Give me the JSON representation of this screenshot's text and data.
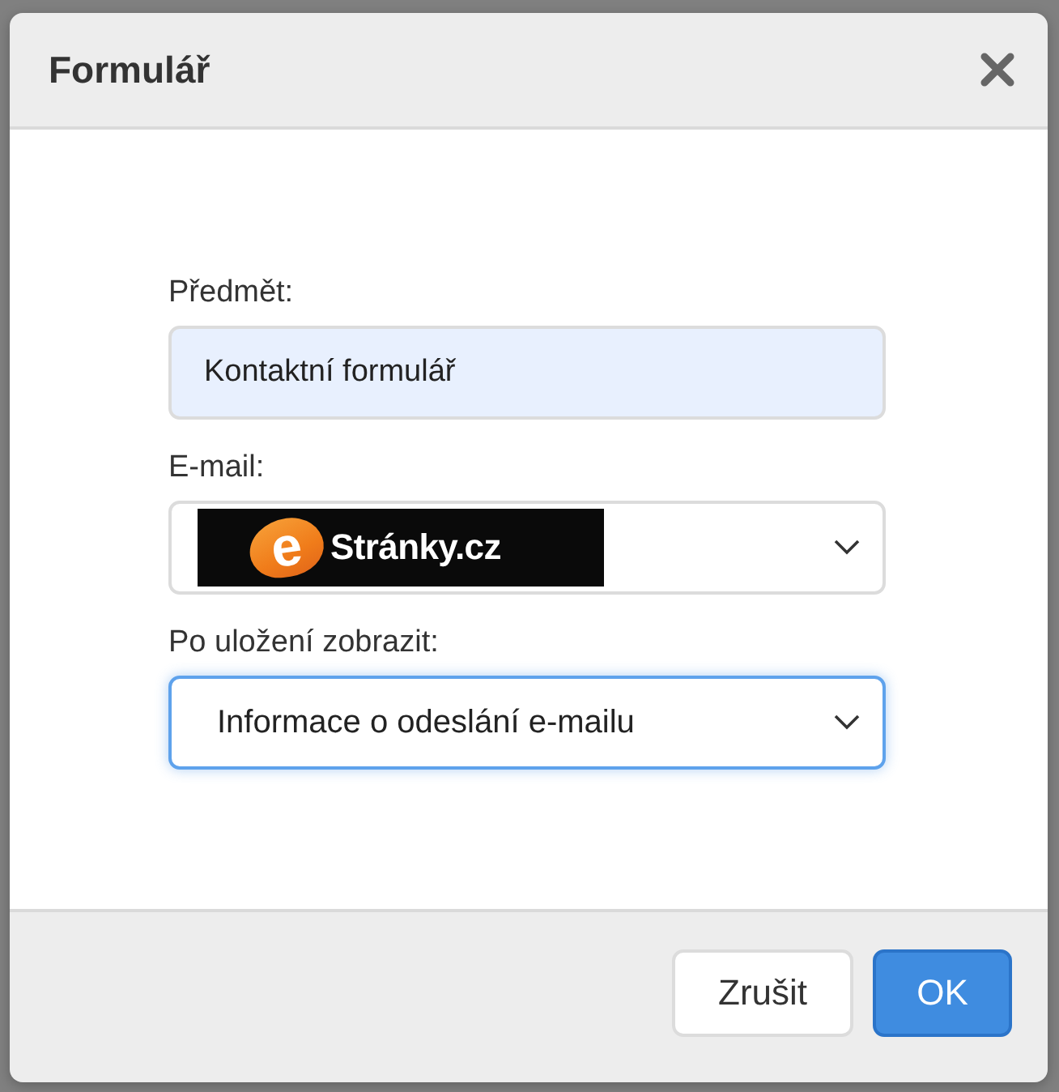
{
  "dialog": {
    "title": "Formulář"
  },
  "fields": [
    {
      "kind": "text",
      "label": "Předmět:",
      "value": "Kontaktní formulář",
      "focused": false
    },
    {
      "kind": "logo_select",
      "label": "E-mail:",
      "logo": {
        "mark": "e",
        "text": "Stránky.cz"
      },
      "focused": false
    },
    {
      "kind": "select",
      "label": "Po uložení zobrazit:",
      "value": "Informace o odeslání e-mailu",
      "focused": true
    }
  ],
  "buttons": [
    {
      "label": "Zrušit",
      "primary": false
    },
    {
      "label": "OK",
      "primary": true
    }
  ]
}
